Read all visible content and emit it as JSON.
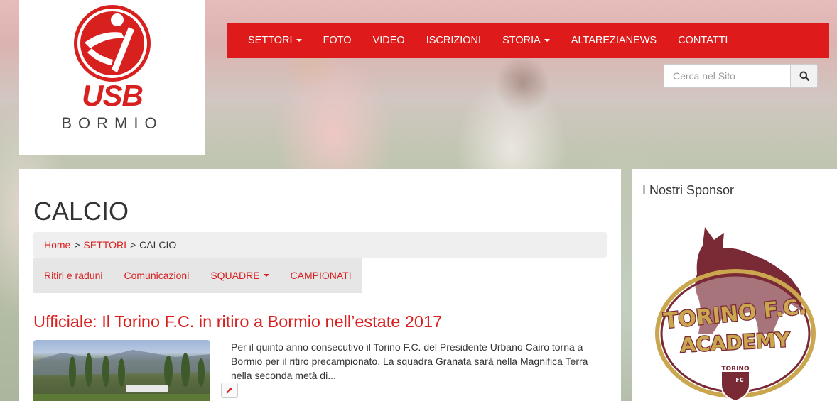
{
  "brand": {
    "abbr": "USB",
    "city": "BORMIO",
    "color": "#d8201f"
  },
  "nav": {
    "color": "#df1a1a",
    "items": [
      {
        "label": "SETTORI",
        "dropdown": true
      },
      {
        "label": "FOTO",
        "dropdown": false
      },
      {
        "label": "VIDEO",
        "dropdown": false
      },
      {
        "label": "ISCRIZIONI",
        "dropdown": false
      },
      {
        "label": "STORIA",
        "dropdown": true
      },
      {
        "label": "ALTAREZIANEWS",
        "dropdown": false
      },
      {
        "label": "CONTATTI",
        "dropdown": false
      }
    ]
  },
  "search": {
    "placeholder": "Cerca nel Sito",
    "icon": "search-icon"
  },
  "page": {
    "title": "CALCIO"
  },
  "breadcrumb": {
    "home": "Home",
    "sep1": ">",
    "section": "SETTORI",
    "sep2": ">",
    "current": "CALCIO"
  },
  "subnav": {
    "items": [
      {
        "label": "Ritiri e raduni",
        "dropdown": false
      },
      {
        "label": "Comunicazioni",
        "dropdown": false
      },
      {
        "label": "SQUADRE",
        "dropdown": true
      },
      {
        "label": "CAMPIONATI",
        "dropdown": false
      }
    ]
  },
  "article": {
    "title": "Ufficiale: Il Torino F.C. in ritiro a Bormio nell’estate 2017",
    "excerpt": "Per il quinto anno consecutivo il Torino F.C. del Presidente Urbano Cairo torna a Bormio per il ritiro precampionato. La squadra Granata sarà nella Magnifica Terra nella seconda metà di...",
    "edit_icon": "pencil-icon"
  },
  "sidebar": {
    "title": "I Nostri Sponsor",
    "sponsor": {
      "line1": "TORINO F.C.",
      "line2": "ACADEMY",
      "badge": "TORINO",
      "badge_sub": "FC",
      "color": "#7a2a35"
    }
  }
}
